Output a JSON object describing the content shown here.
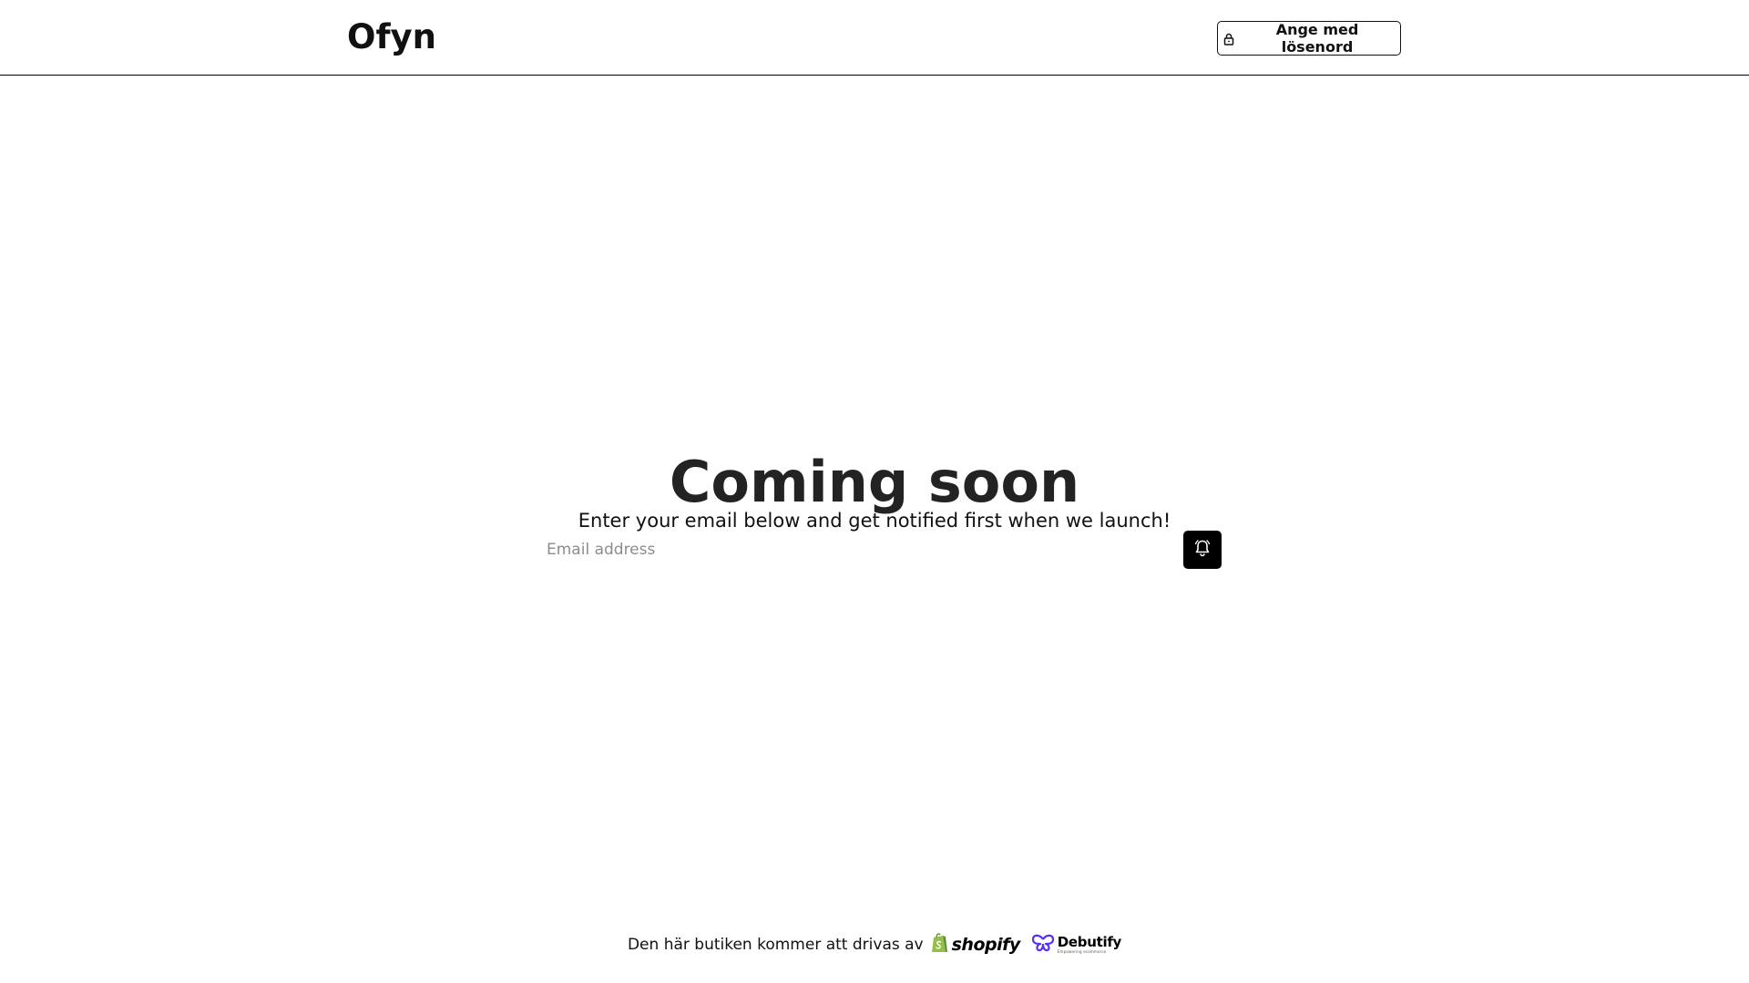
{
  "header": {
    "logo_text": "Ofyn",
    "password_button_label": "Ange med lösenord"
  },
  "main": {
    "heading": "Coming soon",
    "subtitle": "Enter your email below and get notified first when we launch!",
    "email_placeholder": "Email address",
    "email_value": ""
  },
  "footer": {
    "powered_by_text": "Den här butiken kommer att drivas av",
    "shopify_wordmark": "shopify",
    "debutify_wordmark": "Debutify",
    "debutify_tagline": "Empowering ecommerce"
  },
  "icons": {
    "password_button": "lock-icon",
    "notify_button": "bell-icon",
    "shopify": "shopify-bag-icon",
    "debutify": "debutify-butterfly-icon"
  },
  "colors": {
    "background": "#ffffff",
    "text": "#111111",
    "heading": "#232323",
    "notify_button_bg": "#000000",
    "placeholder": "#8c8c8c",
    "shopify_green": "#95bf47",
    "debutify_purple": "#5a31f4"
  }
}
